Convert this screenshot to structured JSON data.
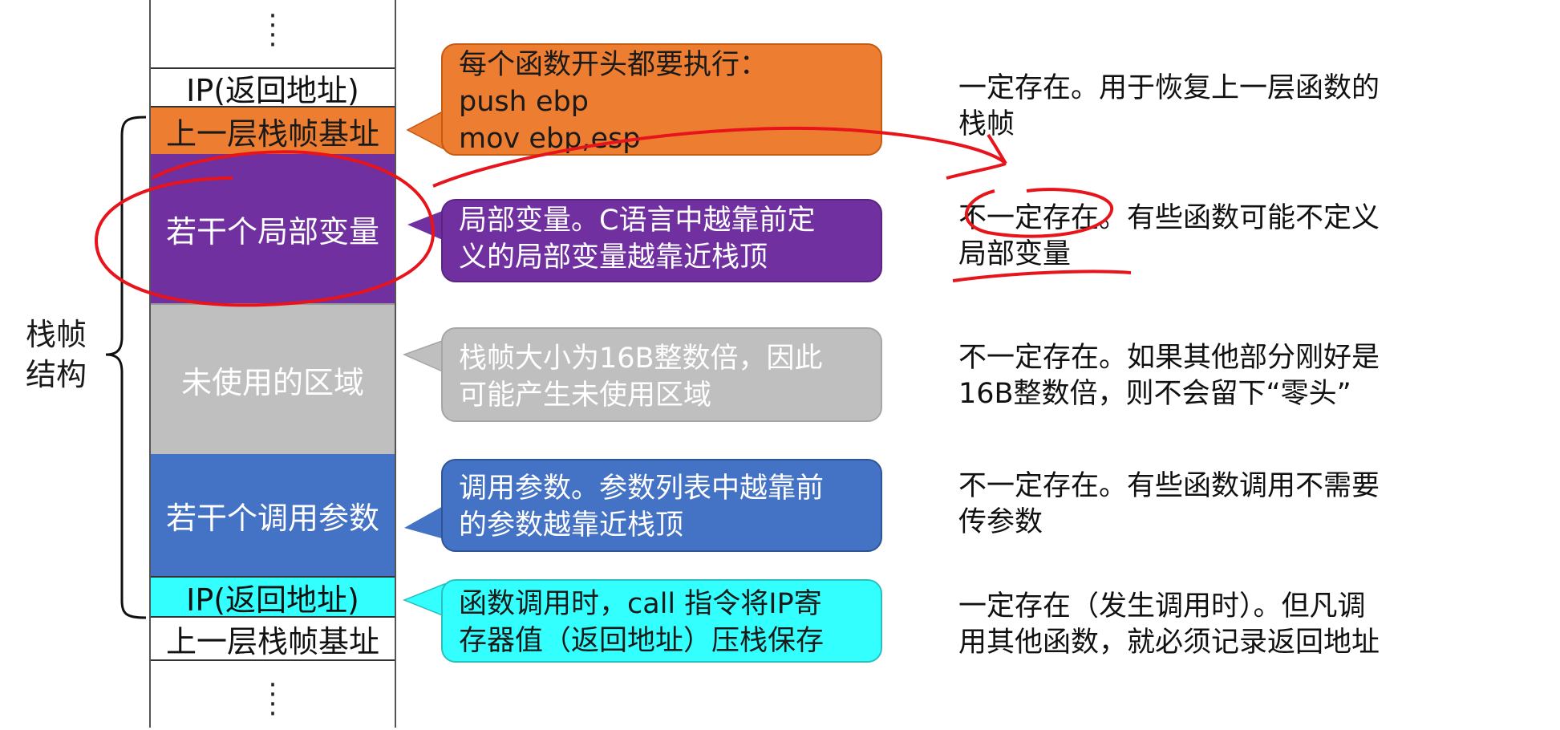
{
  "stack": {
    "cells": [
      {
        "label": "IP(返回地址)",
        "color": "#ffffff"
      },
      {
        "label": "上一层栈帧基址",
        "color": "#ed7d31"
      },
      {
        "label": "若干个局部变量",
        "color": "#7030a0"
      },
      {
        "label": "未使用的区域",
        "color": "#bfbfbf"
      },
      {
        "label": "若干个调用参数",
        "color": "#4472c4"
      },
      {
        "label": "IP(返回地址)",
        "color": "#33ffff"
      },
      {
        "label": "上一层栈帧基址",
        "color": "#ffffff"
      }
    ],
    "ellipsis_top": "⋮",
    "ellipsis_bottom": "⋮",
    "frame_label": "栈帧\n结构"
  },
  "callouts": [
    {
      "line1": "每个函数开头都要执行：",
      "line2": "push ebp",
      "line3": "mov ebp,esp",
      "color": "#ed7d31"
    },
    {
      "line1": "局部变量。C语言中越靠前定",
      "line2": "义的局部变量越靠近栈顶",
      "color": "#7030a0"
    },
    {
      "line1": "栈帧大小为16B整数倍，因此",
      "line2": "可能产生未使用区域",
      "color": "#bfbfbf"
    },
    {
      "line1": "调用参数。参数列表中越靠前",
      "line2": "的参数越靠近栈顶",
      "color": "#4472c4"
    },
    {
      "line1": "函数调用时，call 指令将IP寄",
      "line2": "存器值（返回地址）压栈保存",
      "color": "#33ffff"
    }
  ],
  "notes": [
    {
      "line1": "一定存在。用于恢复上一层函数的",
      "line2": "栈帧"
    },
    {
      "line1": "不一定存在。有些函数可能不定义",
      "line2": "局部变量"
    },
    {
      "line1": "不一定存在。如果其他部分刚好是",
      "line2": "16B整数倍，则不会留下“零头”"
    },
    {
      "line1": "不一定存在。有些函数调用不需要",
      "line2": "传参数"
    },
    {
      "line1": "一定存在（发生调用时）。但凡调",
      "line2": "用其他函数，就必须记录返回地址"
    }
  ],
  "annotation_color": "#e8141b"
}
